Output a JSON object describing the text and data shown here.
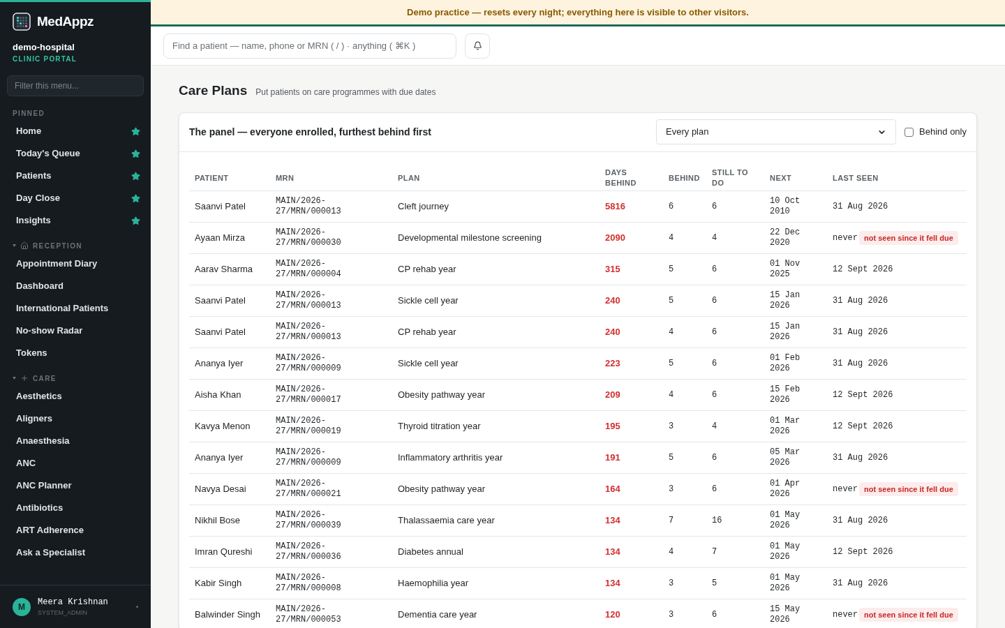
{
  "brand": {
    "name": "MedAppz",
    "org": "demo-hospital",
    "portal": "CLINIC PORTAL"
  },
  "sidebar": {
    "filter_placeholder": "Filter this menu...",
    "sections": [
      {
        "title": "PINNED",
        "kind": "pinned",
        "items": [
          {
            "label": "Home",
            "pinned": true
          },
          {
            "label": "Today's Queue",
            "pinned": true
          },
          {
            "label": "Patients",
            "pinned": true
          },
          {
            "label": "Day Close",
            "pinned": true
          },
          {
            "label": "Insights",
            "pinned": true
          }
        ]
      },
      {
        "title": "RECEPTION",
        "kind": "reception",
        "expanded": true,
        "items": [
          {
            "label": "Appointment Diary",
            "pinned": false
          },
          {
            "label": "Dashboard",
            "pinned": false
          },
          {
            "label": "International Patients",
            "pinned": false
          },
          {
            "label": "No-show Radar",
            "pinned": false
          },
          {
            "label": "Tokens",
            "pinned": false
          }
        ]
      },
      {
        "title": "CARE",
        "kind": "care",
        "expanded": true,
        "items": [
          {
            "label": "Aesthetics",
            "pinned": false
          },
          {
            "label": "Aligners",
            "pinned": false
          },
          {
            "label": "Anaesthesia",
            "pinned": false
          },
          {
            "label": "ANC",
            "pinned": false
          },
          {
            "label": "ANC Planner",
            "pinned": false
          },
          {
            "label": "Antibiotics",
            "pinned": false
          },
          {
            "label": "ART Adherence",
            "pinned": false
          },
          {
            "label": "Ask a Specialist",
            "pinned": false
          }
        ]
      }
    ],
    "user": {
      "initial": "M",
      "name": "Meera Krishnan",
      "role": "SYSTEM_ADMIN"
    }
  },
  "banner": "Demo practice — resets every night; everything here is visible to other visitors.",
  "search": {
    "placeholder": "Find a patient — name, phone or MRN ( / ) · anything ( ⌘K )"
  },
  "page": {
    "title": "Care Plans",
    "subtitle": "Put patients on care programmes with due dates"
  },
  "panel": {
    "title": "The panel — everyone enrolled, furthest behind first",
    "plan_filter": "Every plan",
    "behind_only": {
      "label": "Behind only",
      "checked": false
    }
  },
  "table": {
    "columns": [
      "PATIENT",
      "MRN",
      "PLAN",
      "DAYS BEHIND",
      "BEHIND",
      "STILL TO DO",
      "NEXT",
      "LAST SEEN"
    ],
    "rows": [
      {
        "patient": "Saanvi Patel",
        "mrn": [
          "MAIN/2026-",
          "27/MRN/000013"
        ],
        "plan": "Cleft journey",
        "days_behind": "5816",
        "behind": "6",
        "still_to_do": "6",
        "next": [
          "10 Oct",
          "2010"
        ],
        "last_seen": "31 Aug 2026"
      },
      {
        "patient": "Ayaan Mirza",
        "mrn": [
          "MAIN/2026-",
          "27/MRN/000030"
        ],
        "plan": "Developmental milestone screening",
        "days_behind": "2090",
        "behind": "4",
        "still_to_do": "4",
        "next": [
          "22 Dec",
          "2020"
        ],
        "last_seen": "never",
        "flag": "not seen since it fell due"
      },
      {
        "patient": "Aarav Sharma",
        "mrn": [
          "MAIN/2026-",
          "27/MRN/000004"
        ],
        "plan": "CP rehab year",
        "days_behind": "315",
        "behind": "5",
        "still_to_do": "6",
        "next": [
          "01 Nov",
          "2025"
        ],
        "last_seen": "12 Sept 2026"
      },
      {
        "patient": "Saanvi Patel",
        "mrn": [
          "MAIN/2026-",
          "27/MRN/000013"
        ],
        "plan": "Sickle cell year",
        "days_behind": "240",
        "behind": "5",
        "still_to_do": "6",
        "next": [
          "15 Jan",
          "2026"
        ],
        "last_seen": "31 Aug 2026"
      },
      {
        "patient": "Saanvi Patel",
        "mrn": [
          "MAIN/2026-",
          "27/MRN/000013"
        ],
        "plan": "CP rehab year",
        "days_behind": "240",
        "behind": "4",
        "still_to_do": "6",
        "next": [
          "15 Jan",
          "2026"
        ],
        "last_seen": "31 Aug 2026"
      },
      {
        "patient": "Ananya Iyer",
        "mrn": [
          "MAIN/2026-",
          "27/MRN/000009"
        ],
        "plan": "Sickle cell year",
        "days_behind": "223",
        "behind": "5",
        "still_to_do": "6",
        "next": [
          "01 Feb",
          "2026"
        ],
        "last_seen": "31 Aug 2026"
      },
      {
        "patient": "Aisha Khan",
        "mrn": [
          "MAIN/2026-",
          "27/MRN/000017"
        ],
        "plan": "Obesity pathway year",
        "days_behind": "209",
        "behind": "4",
        "still_to_do": "6",
        "next": [
          "15 Feb",
          "2026"
        ],
        "last_seen": "12 Sept 2026"
      },
      {
        "patient": "Kavya Menon",
        "mrn": [
          "MAIN/2026-",
          "27/MRN/000019"
        ],
        "plan": "Thyroid titration year",
        "days_behind": "195",
        "behind": "3",
        "still_to_do": "4",
        "next": [
          "01 Mar",
          "2026"
        ],
        "last_seen": "12 Sept 2026"
      },
      {
        "patient": "Ananya Iyer",
        "mrn": [
          "MAIN/2026-",
          "27/MRN/000009"
        ],
        "plan": "Inflammatory arthritis year",
        "days_behind": "191",
        "behind": "5",
        "still_to_do": "6",
        "next": [
          "05 Mar",
          "2026"
        ],
        "last_seen": "31 Aug 2026"
      },
      {
        "patient": "Navya Desai",
        "mrn": [
          "MAIN/2026-",
          "27/MRN/000021"
        ],
        "plan": "Obesity pathway year",
        "days_behind": "164",
        "behind": "3",
        "still_to_do": "6",
        "next": [
          "01 Apr",
          "2026"
        ],
        "last_seen": "never",
        "flag": "not seen since it fell due"
      },
      {
        "patient": "Nikhil Bose",
        "mrn": [
          "MAIN/2026-",
          "27/MRN/000039"
        ],
        "plan": "Thalassaemia care year",
        "days_behind": "134",
        "behind": "7",
        "still_to_do": "16",
        "next": [
          "01 May",
          "2026"
        ],
        "last_seen": "31 Aug 2026"
      },
      {
        "patient": "Imran Qureshi",
        "mrn": [
          "MAIN/2026-",
          "27/MRN/000036"
        ],
        "plan": "Diabetes annual",
        "days_behind": "134",
        "behind": "4",
        "still_to_do": "7",
        "next": [
          "01 May",
          "2026"
        ],
        "last_seen": "12 Sept 2026"
      },
      {
        "patient": "Kabir Singh",
        "mrn": [
          "MAIN/2026-",
          "27/MRN/000008"
        ],
        "plan": "Haemophilia year",
        "days_behind": "134",
        "behind": "3",
        "still_to_do": "5",
        "next": [
          "01 May",
          "2026"
        ],
        "last_seen": "31 Aug 2026"
      },
      {
        "patient": "Balwinder Singh",
        "mrn": [
          "MAIN/2026-",
          "27/MRN/000053"
        ],
        "plan": "Dementia care year",
        "days_behind": "120",
        "behind": "3",
        "still_to_do": "6",
        "next": [
          "15 May",
          "2026"
        ],
        "last_seen": "never",
        "flag": "not seen since it fell due"
      }
    ]
  }
}
